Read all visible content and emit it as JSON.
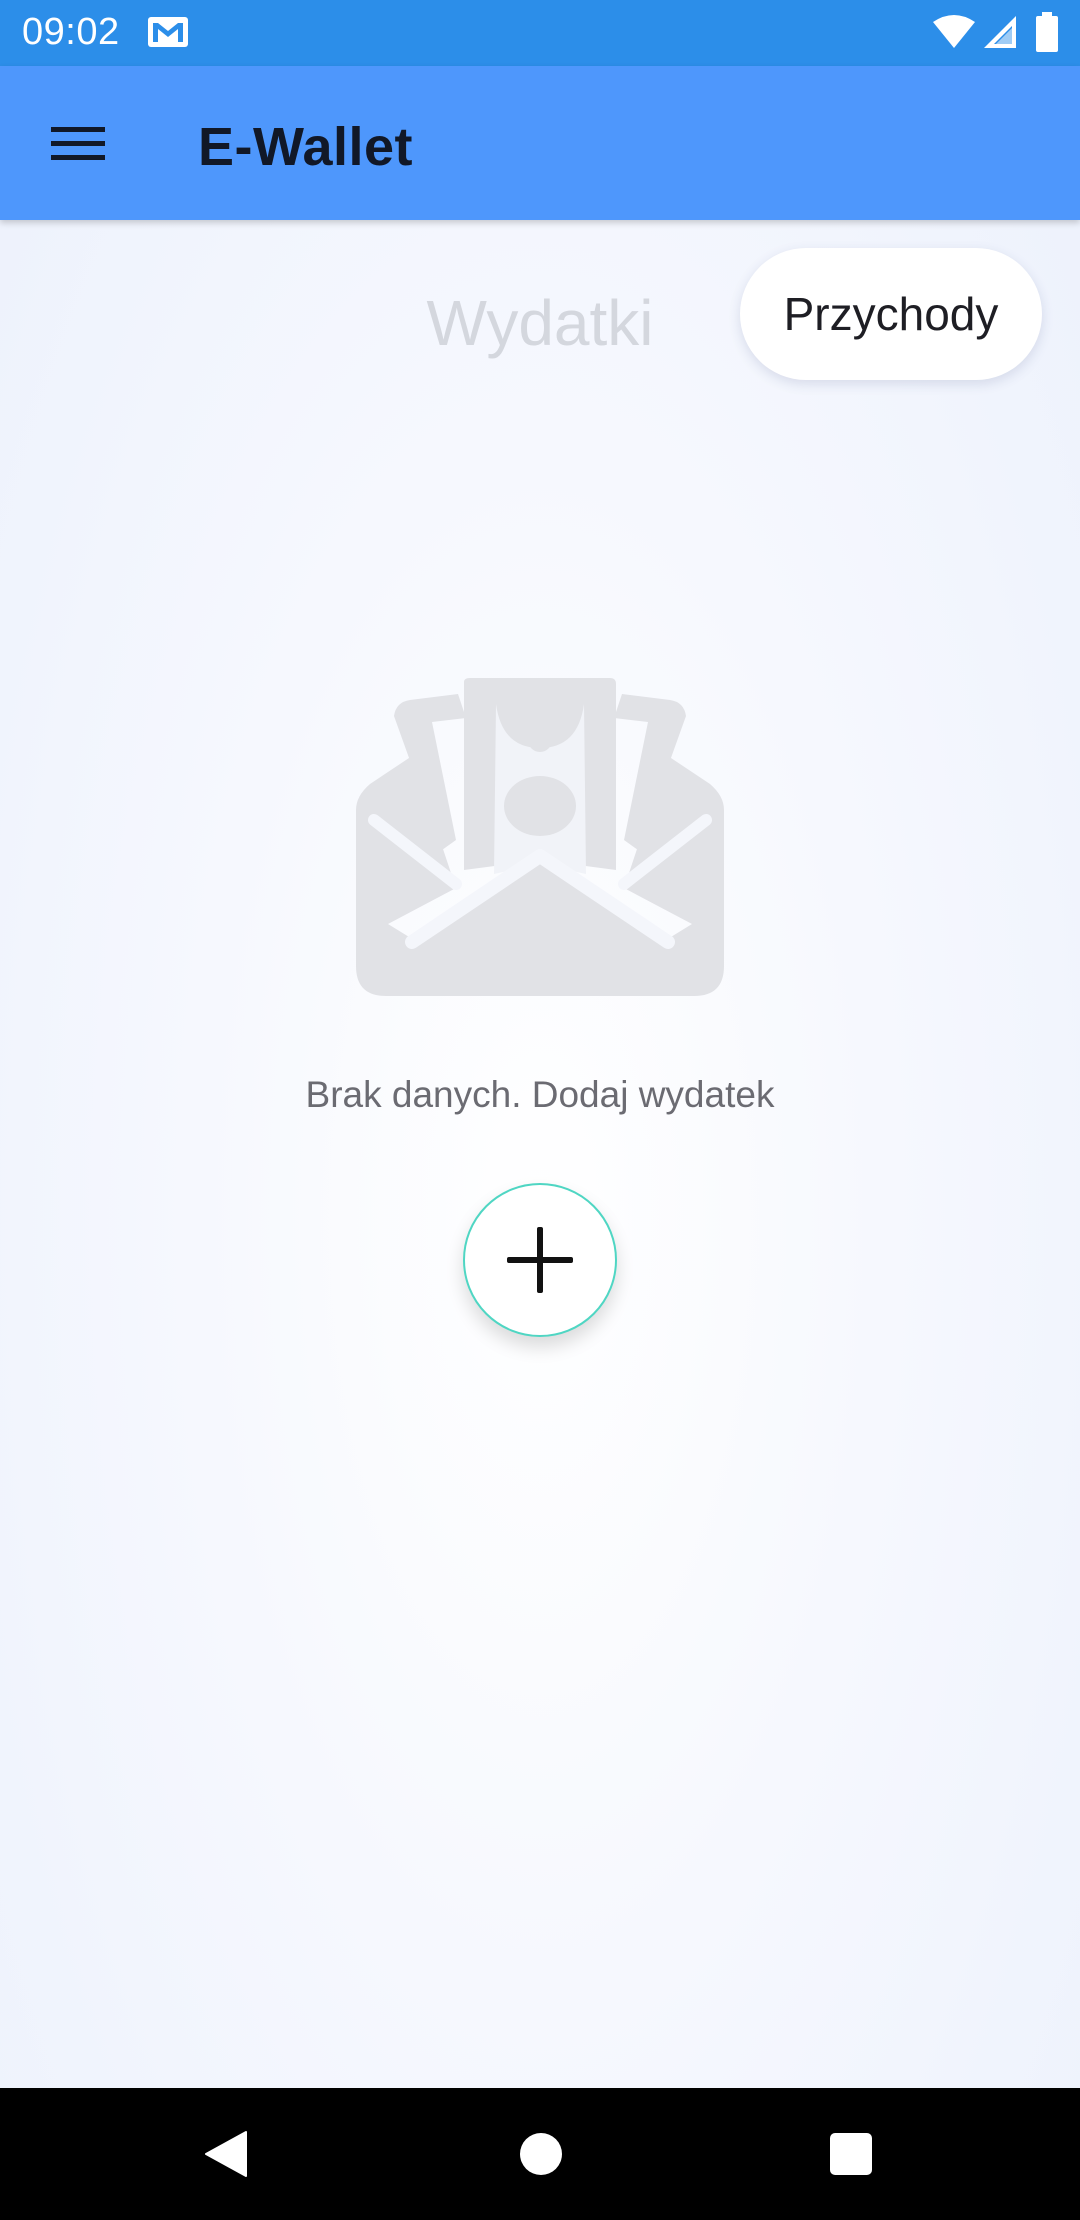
{
  "status_bar": {
    "time": "09:02",
    "icons": [
      "mail-icon",
      "wifi-icon",
      "signal-icon",
      "battery-icon"
    ]
  },
  "app_bar": {
    "title": "E-Wallet",
    "menu_icon": "menu-icon",
    "background_color": "#4e97fc"
  },
  "segment": {
    "tabs": [
      {
        "label": "Wydatki",
        "selected": false
      },
      {
        "label": "Przychody",
        "selected": true
      }
    ]
  },
  "empty_state": {
    "icon": "money-envelope-icon",
    "message": "Brak danych. Dodaj wydatek"
  },
  "fab": {
    "icon": "plus-icon",
    "border_color": "#4fd6c3"
  },
  "nav_bar": {
    "icons": [
      "back-icon",
      "home-icon",
      "recents-icon"
    ]
  },
  "colors": {
    "status_bar": "#2c8ee9",
    "accent": "#4e97fc"
  }
}
